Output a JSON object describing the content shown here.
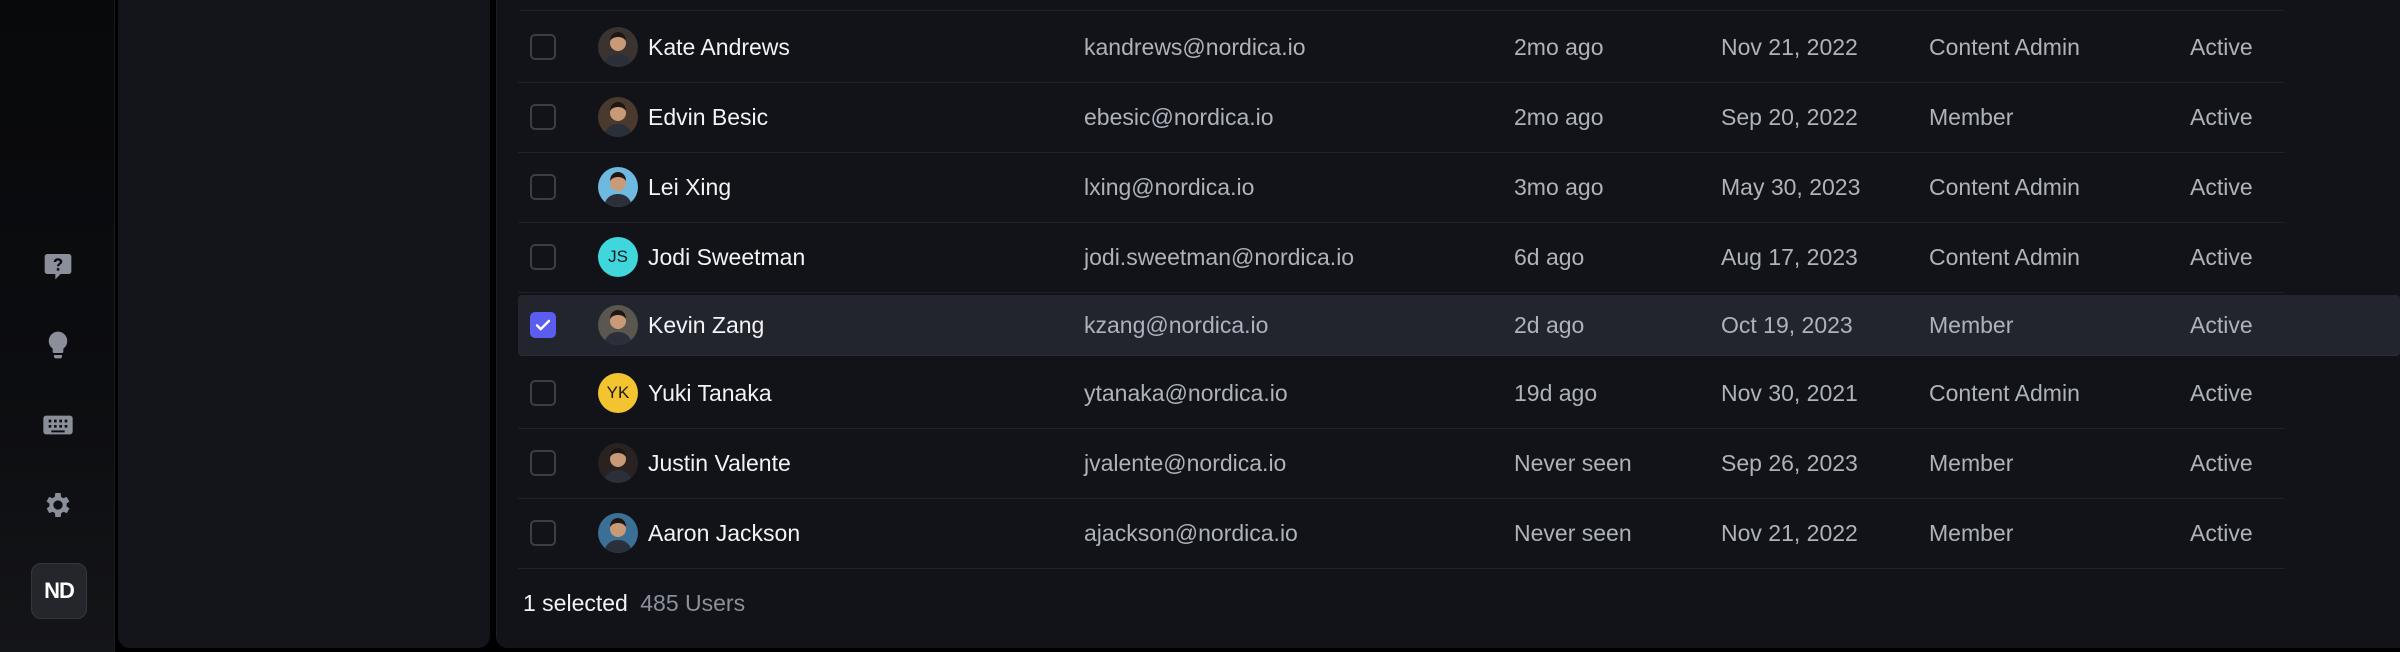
{
  "rail": {
    "icons": [
      "help-icon",
      "lightbulb-icon",
      "keyboard-icon",
      "gear-icon"
    ],
    "logo": "ND"
  },
  "users": [
    {
      "name": "Kate Andrews",
      "email": "kandrews@nordica.io",
      "last_seen": "2mo ago",
      "joined": "Nov 21, 2022",
      "role": "Content Admin",
      "status": "Active",
      "avatar": {
        "type": "photo",
        "bg": "#3a3330"
      },
      "selected": false
    },
    {
      "name": "Edvin Besic",
      "email": "ebesic@nordica.io",
      "last_seen": "2mo ago",
      "joined": "Sep 20, 2022",
      "role": "Member",
      "status": "Active",
      "avatar": {
        "type": "photo",
        "bg": "#4a3a2e"
      },
      "selected": false
    },
    {
      "name": "Lei Xing",
      "email": "lxing@nordica.io",
      "last_seen": "3mo ago",
      "joined": "May 30, 2023",
      "role": "Content Admin",
      "status": "Active",
      "avatar": {
        "type": "photo",
        "bg": "#6fb8e0"
      },
      "selected": false
    },
    {
      "name": "Jodi Sweetman",
      "email": "jodi.sweetman@nordica.io",
      "last_seen": "6d ago",
      "joined": "Aug 17, 2023",
      "role": "Content Admin",
      "status": "Active",
      "avatar": {
        "type": "initials",
        "initials": "JS",
        "bg": "#3fd6dc"
      },
      "selected": false
    },
    {
      "name": "Kevin Zang",
      "email": "kzang@nordica.io",
      "last_seen": "2d ago",
      "joined": "Oct 19, 2023",
      "role": "Member",
      "status": "Active",
      "avatar": {
        "type": "photo",
        "bg": "#5a5650"
      },
      "selected": true
    },
    {
      "name": "Yuki Tanaka",
      "email": "ytanaka@nordica.io",
      "last_seen": "19d ago",
      "joined": "Nov 30, 2021",
      "role": "Content Admin",
      "status": "Active",
      "avatar": {
        "type": "initials",
        "initials": "YK",
        "bg": "#f4c430"
      },
      "selected": false
    },
    {
      "name": "Justin Valente",
      "email": "jvalente@nordica.io",
      "last_seen": "Never seen",
      "joined": "Sep 26, 2023",
      "role": "Member",
      "status": "Active",
      "avatar": {
        "type": "photo",
        "bg": "#2a2220"
      },
      "selected": false
    },
    {
      "name": "Aaron Jackson",
      "email": "ajackson@nordica.io",
      "last_seen": "Never seen",
      "joined": "Nov 21, 2022",
      "role": "Member",
      "status": "Active",
      "avatar": {
        "type": "photo",
        "bg": "#3b6f96"
      },
      "selected": false
    }
  ],
  "footer": {
    "selected_text": "1 selected",
    "count_text": "485 Users"
  },
  "colors": {
    "accent": "#5b5cf0",
    "background": "#111319"
  }
}
